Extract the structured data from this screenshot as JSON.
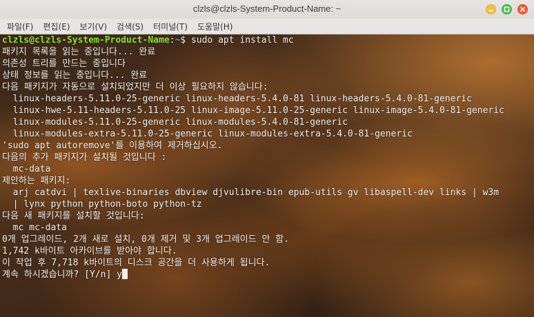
{
  "window": {
    "title": "clzls@clzls-System-Product-Name: ~",
    "buttons": [
      {
        "name": "minimize",
        "color": "#f4bf3f"
      },
      {
        "name": "maximize",
        "color": "#4cc052"
      },
      {
        "name": "close",
        "color": "#ef5a2d"
      }
    ]
  },
  "menu": {
    "items": [
      "파일(F)",
      "편집(E)",
      "보기(V)",
      "검색(S)",
      "터미널(T)",
      "도움말(H)"
    ]
  },
  "terminal": {
    "prompt": {
      "user_host": "clzls@clzls-System-Product-Name",
      "separator": ":",
      "path": "~",
      "symbol": "$ ",
      "command": "sudo apt install mc"
    },
    "lines": [
      "패키지 목록을 읽는 중입니다... 완료",
      "의존성 트리를 만드는 중입니다",
      "상태 정보를 읽는 중입니다... 완료",
      "다음 패키지가 자동으로 설치되었지만 더 이상 필요하지 않습니다:",
      "  linux-headers-5.11.0-25-generic linux-headers-5.4.0-81 linux-headers-5.4.0-81-generic",
      "  linux-hwe-5.11-headers-5.11.0-25 linux-image-5.11.0-25-generic linux-image-5.4.0-81-generic",
      "  linux-modules-5.11.0-25-generic linux-modules-5.4.0-81-generic",
      "  linux-modules-extra-5.11.0-25-generic linux-modules-extra-5.4.0-81-generic",
      "'sudo apt autoremove'를 이용하여 제거하십시오.",
      "다음의 추가 패키지가 설치될 것입니다 :",
      "  mc-data",
      "제안하는 패키지:",
      "  arj catdvi | texlive-binaries dbview djvulibre-bin epub-utils gv libaspell-dev links | w3m",
      "  | lynx python python-boto python-tz",
      "다음 새 패키지를 설치할 것입니다:",
      "  mc mc-data",
      "0개 업그레이드, 2개 새로 설치, 0개 제거 및 3개 업그레이드 안 함.",
      "1,742 k바이트 아카이브를 받아야 합니다.",
      "이 작업 후 7,718 k바이트의 디스크 공간을 더 사용하게 됩니다."
    ],
    "question": "계속 하시겠습니까? [Y/n] ",
    "input": "y"
  }
}
